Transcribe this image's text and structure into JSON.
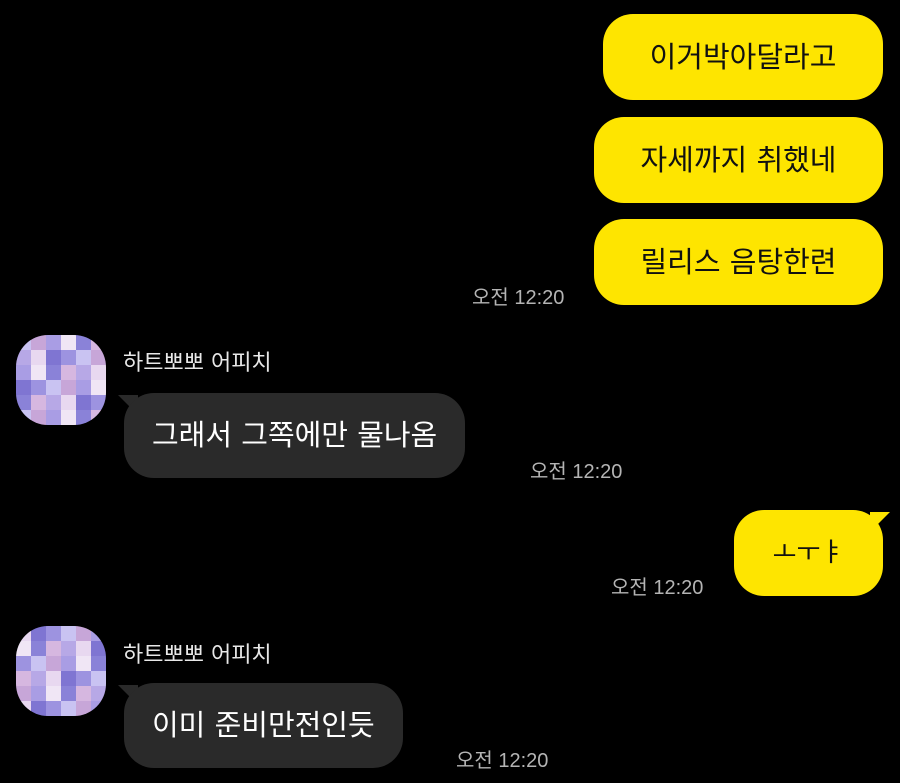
{
  "messages": [
    {
      "id": "m1",
      "from": "me",
      "text": "이거박아달라고"
    },
    {
      "id": "m2",
      "from": "me",
      "text": "자세까지 취했네"
    },
    {
      "id": "m3",
      "from": "me",
      "text": "릴리스 음탕한련",
      "time": "오전 12:20"
    },
    {
      "id": "m4",
      "from": "other",
      "sender": "하트뽀뽀 어피치",
      "text": "그래서 그쪽에만 물나옴",
      "time": "오전 12:20"
    },
    {
      "id": "m5",
      "from": "me",
      "text": "ㅗㅜㅑ",
      "time": "오전 12:20"
    },
    {
      "id": "m6",
      "from": "other",
      "sender": "하트뽀뽀 어피치",
      "text": "이미 준비만전인듯",
      "time": "오전 12:20"
    }
  ],
  "colors": {
    "background": "#000000",
    "my_bubble": "#fee500",
    "their_bubble": "#2a2a2a",
    "timestamp": "#b4b4b4"
  },
  "avatar": {
    "icon": "pixelated-profile-avatar"
  }
}
